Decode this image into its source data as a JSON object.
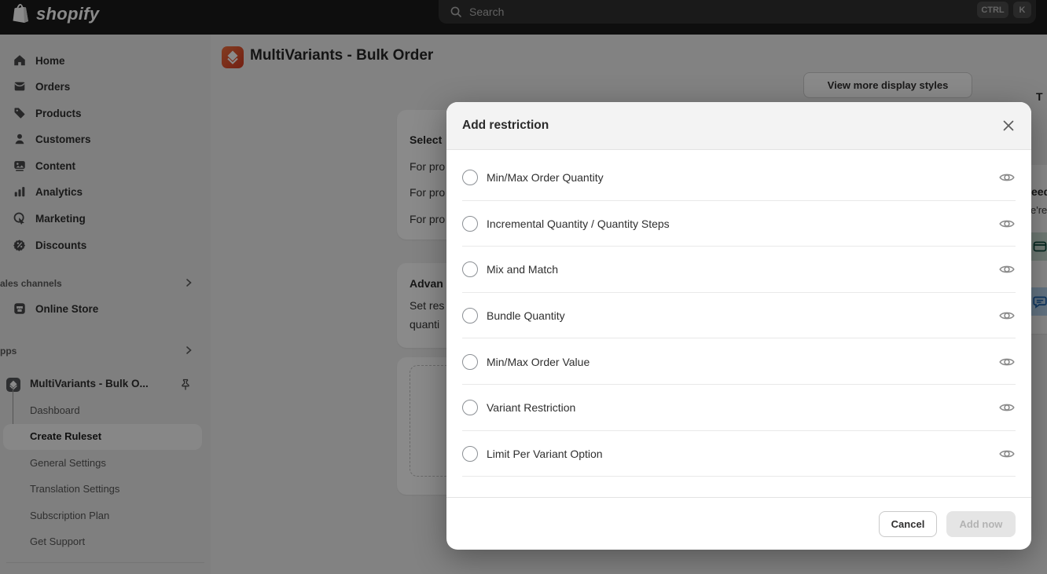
{
  "topbar": {
    "logo": "shopify",
    "search_placeholder": "Search",
    "kbd_ctrl": "CTRL",
    "kbd_k": "K"
  },
  "sidebar": {
    "nav": [
      "Home",
      "Orders",
      "Products",
      "Customers",
      "Content",
      "Analytics",
      "Marketing",
      "Discounts"
    ],
    "sales_channels_header": "ales channels",
    "online_store_label": "Online Store",
    "apps_header": "pps",
    "app_name": "MultiVariants - Bulk O...",
    "app_nav": [
      "Dashboard",
      "Create Ruleset",
      "General Settings",
      "Translation Settings",
      "Subscription Plan",
      "Get Support"
    ],
    "active_item": "Create Ruleset"
  },
  "main": {
    "page_title": "MultiVariants - Bulk Order",
    "view_more_button": "View more display styles",
    "select_card": {
      "heading": "Select",
      "lines": [
        "For pro",
        "For pro",
        "For pro"
      ]
    },
    "advanced_card": {
      "heading": "Advan",
      "lines": [
        "Set res",
        "quanti"
      ]
    },
    "right_panel": {
      "title_fragment": "T",
      "heading_fragment": "eed",
      "text_fragment": "e're"
    }
  },
  "modal": {
    "title": "Add restriction",
    "options": [
      "Min/Max Order Quantity",
      "Incremental Quantity / Quantity Steps",
      "Mix and Match",
      "Bundle Quantity",
      "Min/Max Order Value",
      "Variant Restriction",
      "Limit Per Variant Option"
    ],
    "cancel_label": "Cancel",
    "submit_label": "Add now"
  },
  "colors": {
    "topbar_bg": "#1a1a1a",
    "sidebar_bg": "#ebebeb",
    "main_bg": "#f1f1f1",
    "overlay": "rgba(0,0,0,0.46)",
    "app_icon_orange": "#e2492e",
    "modal_header_bg": "#f3f3f3",
    "green_tile": "#cfe3d9",
    "blue_tile": "#b9d8f4"
  }
}
